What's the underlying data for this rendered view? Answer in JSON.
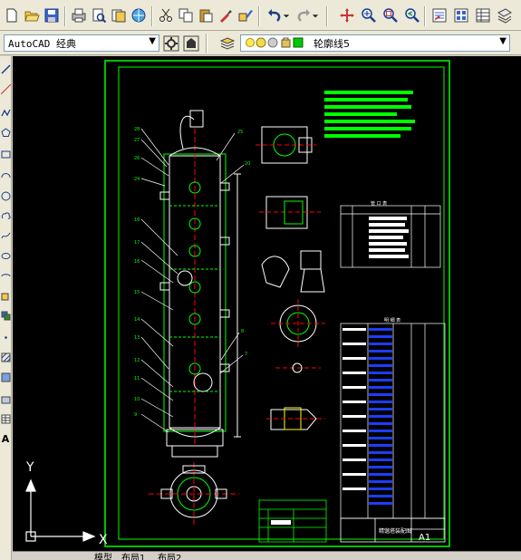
{
  "window": {
    "workspace": "AutoCAD 经典",
    "layer": "轮廓线5"
  },
  "toolbar_standard": {
    "icons": [
      "new-icon",
      "open-icon",
      "save-icon",
      "print-icon",
      "print-preview-icon",
      "publish-icon",
      "3d-dwf-icon",
      "cut-icon",
      "copy-icon",
      "paste-icon",
      "match-properties-icon",
      "block-editor-icon",
      "undo-icon",
      "redo-icon",
      "pan-icon",
      "zoom-realtime-icon",
      "zoom-window-icon",
      "zoom-previous-icon",
      "properties-icon",
      "design-center-icon",
      "tool-palettes-icon",
      "sheet-set-icon",
      "markup-icon"
    ]
  },
  "drawing": {
    "tables": {
      "parts_list_title": "明 细 表",
      "nozzle_table_title": "管 口 表",
      "title_block_name": "精馏塔装配图",
      "sheet_size": "A1"
    },
    "ucs": {
      "x_label": "X",
      "y_label": "Y"
    }
  },
  "layout_tabs": {
    "model": "模型",
    "layout1": "布局1",
    "layout2": "布局2"
  },
  "colors": {
    "background": "#000000",
    "frame": "#00ff00",
    "linework": "#ffffff",
    "highlight": "#00ff00",
    "table_fill": "#1e3cff",
    "centerline": "#ff0000",
    "dim": "#ffff00"
  }
}
